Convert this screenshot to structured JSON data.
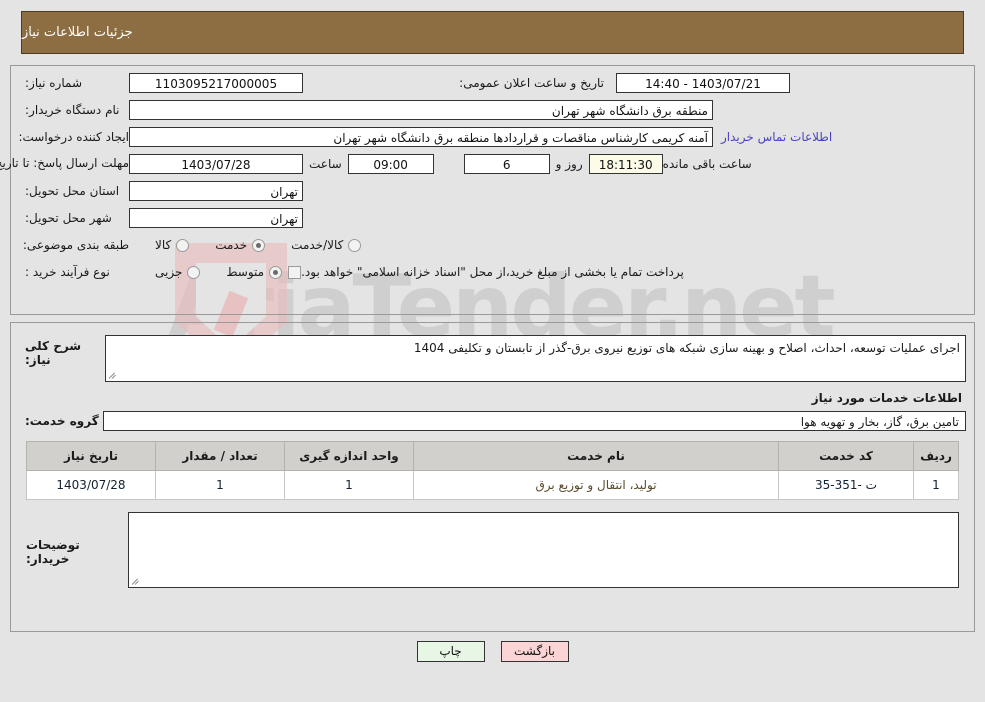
{
  "header": {
    "title": "جزئیات اطلاعات نیاز"
  },
  "form": {
    "need_number_label": "شماره نیاز:",
    "need_number_value": "1103095217000005",
    "public_announce_label": "تاریخ و ساعت اعلان عمومی:",
    "public_announce_value": "1403/07/21 - 14:40",
    "buyer_org_label": "نام دستگاه خریدار:",
    "buyer_org_value": "منطقه برق دانشگاه شهر تهران",
    "creator_label": "ایجاد کننده درخواست:",
    "creator_value": "آمنه کریمی کارشناس مناقصات و قراردادها منطقه برق دانشگاه شهر تهران",
    "contact_link": "اطلاعات تماس خریدار",
    "deadline_label": "مهلت ارسال پاسخ: تا تاریخ:",
    "deadline_date": "1403/07/28",
    "deadline_time_label": "ساعت",
    "deadline_time": "09:00",
    "remaining_days": "6",
    "remaining_days_label": "روز و",
    "remaining_time": "18:11:30",
    "remaining_time_label": "ساعت باقی مانده",
    "province_label": "استان محل تحویل:",
    "province_value": "تهران",
    "city_label": "شهر محل تحویل:",
    "city_value": "تهران",
    "category_label": "طبقه بندی موضوعی:",
    "category_options": [
      {
        "label": "کالا",
        "selected": false
      },
      {
        "label": "خدمت",
        "selected": true
      },
      {
        "label": "کالا/خدمت",
        "selected": false
      }
    ],
    "purchase_type_label": "نوع فرآیند خرید :",
    "purchase_type_options": [
      {
        "label": "جزیی",
        "selected": false
      },
      {
        "label": "متوسط",
        "selected": true
      }
    ],
    "treasury_checkbox_checked": false,
    "treasury_note": "پرداخت تمام یا بخشی از مبلغ خرید،از محل \"اسناد خزانه اسلامی\" خواهد بود."
  },
  "description": {
    "label": "شرح کلی نیاز:",
    "value": "اجرای عملیات توسعه، احداث، اصلاح و بهینه سازی شبکه های توزیع نیروی برق-گذر از تابستان و تکلیفی 1404"
  },
  "services": {
    "section_title": "اطلاعات خدمات مورد نیاز",
    "group_label": "گروه خدمت:",
    "group_value": "تامین برق، گاز، بخار و تهویه هوا",
    "columns": [
      "ردیف",
      "کد خدمت",
      "نام خدمت",
      "واحد اندازه گیری",
      "تعداد / مقدار",
      "تاریخ نیاز"
    ],
    "rows": [
      {
        "index": "1",
        "code": "ت -351-35",
        "name": "تولید، انتقال و توزیع برق",
        "unit": "1",
        "quantity": "1",
        "need_date": "1403/07/28"
      }
    ]
  },
  "comments": {
    "label": "توضیحات خریدار:",
    "value": ""
  },
  "footer": {
    "print_label": "چاپ",
    "back_label": "بازگشت"
  },
  "watermark": {
    "text": "AriaTender.net"
  },
  "colors": {
    "header_brown": "#8d6e43",
    "link_blue": "#4b41c8",
    "table_header_gray": "#d2d0cd",
    "print_green": "#e8f6e6",
    "back_pink": "#fbd5d5",
    "cream_field": "#fbfbe8"
  }
}
